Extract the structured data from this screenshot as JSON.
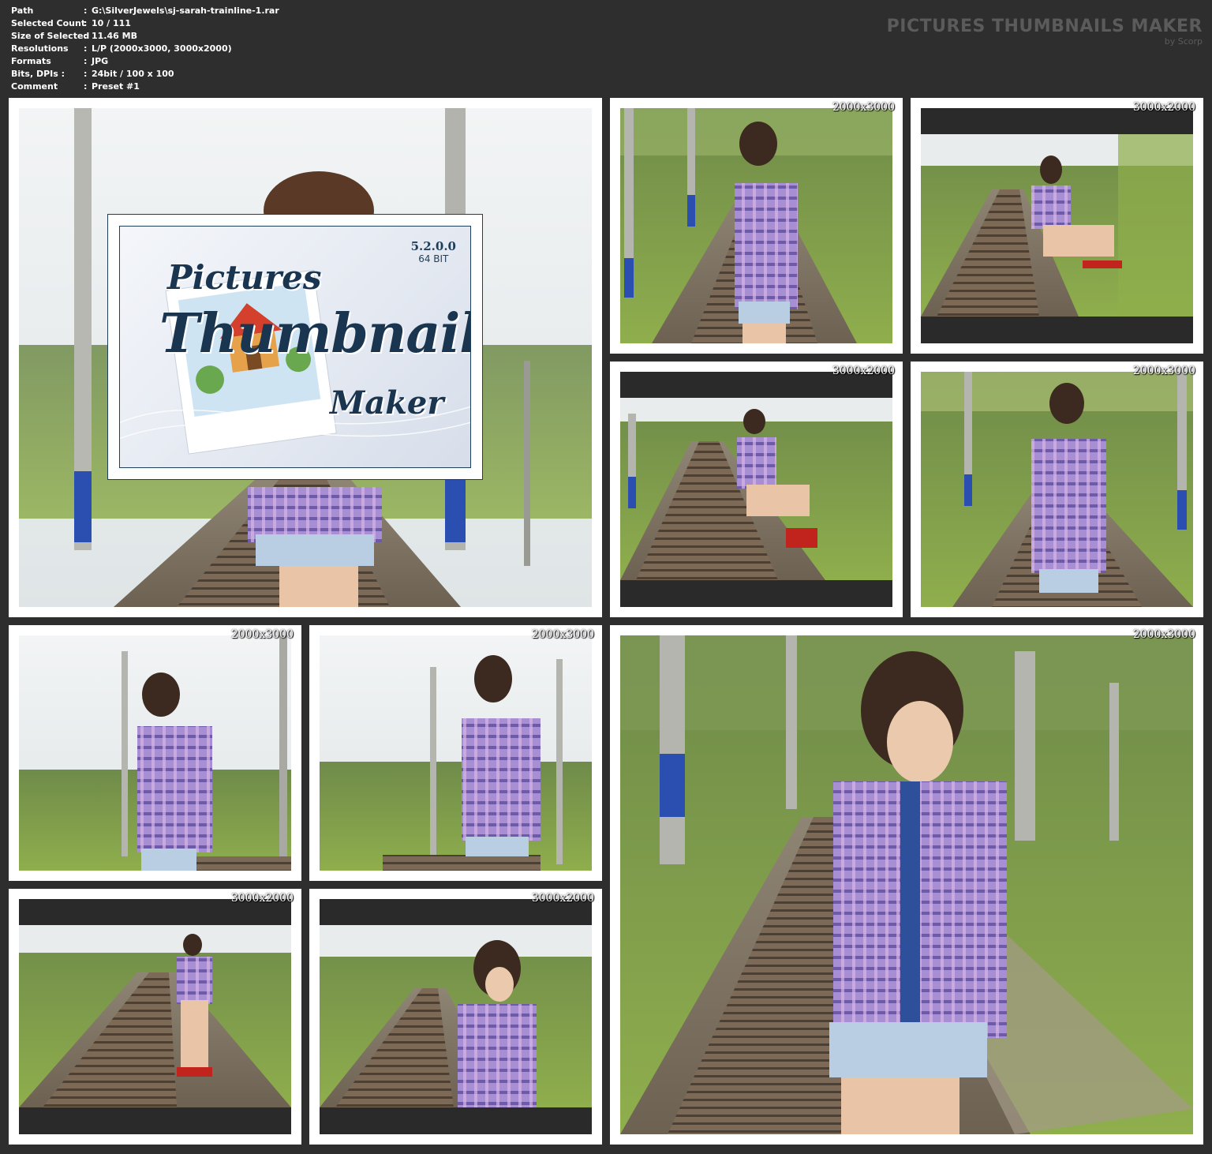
{
  "header": {
    "rows": [
      {
        "key": "Path",
        "value": "G:\\SilverJewels\\sj-sarah-trainline-1.rar"
      },
      {
        "key": "Selected Count",
        "value": "10 / 111"
      },
      {
        "key": "Size of Selected",
        "value": "11.46 MB"
      },
      {
        "key": "Resolutions",
        "value": "L/P (2000x3000, 3000x2000)"
      },
      {
        "key": "Formats",
        "value": "JPG"
      },
      {
        "key": "Bits, DPIs :",
        "value": "24bit / 100 x 100"
      },
      {
        "key": "Comment",
        "value": "Preset #1"
      }
    ],
    "separator": ":",
    "brand_title": "PICTURES THUMBNAILS MAKER",
    "brand_sub": "by Scorp"
  },
  "logo": {
    "version": "5.2.0.0",
    "bits": "64 BIT",
    "word1": "Pictures",
    "word2": "Thumbnails",
    "word3": "Maker"
  },
  "thumbnails": [
    {
      "id": "large-1",
      "resolution": "",
      "orientation": "portrait",
      "has_logo": true
    },
    {
      "id": "t2",
      "resolution": "2000x3000",
      "orientation": "portrait"
    },
    {
      "id": "t3",
      "resolution": "3000x2000",
      "orientation": "landscape"
    },
    {
      "id": "t4",
      "resolution": "3000x2000",
      "orientation": "landscape"
    },
    {
      "id": "t5",
      "resolution": "2000x3000",
      "orientation": "portrait"
    },
    {
      "id": "t6",
      "resolution": "2000x3000",
      "orientation": "portrait"
    },
    {
      "id": "t7",
      "resolution": "2000x3000",
      "orientation": "portrait"
    },
    {
      "id": "large-8",
      "resolution": "2000x3000",
      "orientation": "portrait"
    },
    {
      "id": "t9",
      "resolution": "3000x2000",
      "orientation": "landscape"
    },
    {
      "id": "t10",
      "resolution": "3000x2000",
      "orientation": "landscape"
    }
  ],
  "colors": {
    "background": "#2e2e2e",
    "tile_frame": "#ffffff",
    "letterbox": "#2a2a2a",
    "logo_ink": "#1a3550"
  }
}
